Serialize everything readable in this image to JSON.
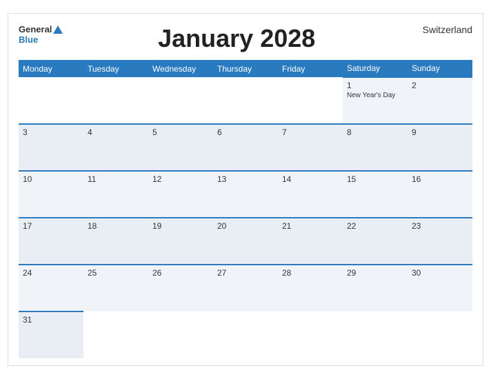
{
  "header": {
    "title": "January 2028",
    "country": "Switzerland",
    "logo_general": "General",
    "logo_blue": "Blue"
  },
  "weekdays": [
    "Monday",
    "Tuesday",
    "Wednesday",
    "Thursday",
    "Friday",
    "Saturday",
    "Sunday"
  ],
  "weeks": [
    [
      {
        "day": "",
        "holiday": ""
      },
      {
        "day": "",
        "holiday": ""
      },
      {
        "day": "",
        "holiday": ""
      },
      {
        "day": "",
        "holiday": ""
      },
      {
        "day": "",
        "holiday": ""
      },
      {
        "day": "1",
        "holiday": "New Year's Day"
      },
      {
        "day": "2",
        "holiday": ""
      }
    ],
    [
      {
        "day": "3",
        "holiday": ""
      },
      {
        "day": "4",
        "holiday": ""
      },
      {
        "day": "5",
        "holiday": ""
      },
      {
        "day": "6",
        "holiday": ""
      },
      {
        "day": "7",
        "holiday": ""
      },
      {
        "day": "8",
        "holiday": ""
      },
      {
        "day": "9",
        "holiday": ""
      }
    ],
    [
      {
        "day": "10",
        "holiday": ""
      },
      {
        "day": "11",
        "holiday": ""
      },
      {
        "day": "12",
        "holiday": ""
      },
      {
        "day": "13",
        "holiday": ""
      },
      {
        "day": "14",
        "holiday": ""
      },
      {
        "day": "15",
        "holiday": ""
      },
      {
        "day": "16",
        "holiday": ""
      }
    ],
    [
      {
        "day": "17",
        "holiday": ""
      },
      {
        "day": "18",
        "holiday": ""
      },
      {
        "day": "19",
        "holiday": ""
      },
      {
        "day": "20",
        "holiday": ""
      },
      {
        "day": "21",
        "holiday": ""
      },
      {
        "day": "22",
        "holiday": ""
      },
      {
        "day": "23",
        "holiday": ""
      }
    ],
    [
      {
        "day": "24",
        "holiday": ""
      },
      {
        "day": "25",
        "holiday": ""
      },
      {
        "day": "26",
        "holiday": ""
      },
      {
        "day": "27",
        "holiday": ""
      },
      {
        "day": "28",
        "holiday": ""
      },
      {
        "day": "29",
        "holiday": ""
      },
      {
        "day": "30",
        "holiday": ""
      }
    ],
    [
      {
        "day": "31",
        "holiday": ""
      },
      {
        "day": "",
        "holiday": ""
      },
      {
        "day": "",
        "holiday": ""
      },
      {
        "day": "",
        "holiday": ""
      },
      {
        "day": "",
        "holiday": ""
      },
      {
        "day": "",
        "holiday": ""
      },
      {
        "day": "",
        "holiday": ""
      }
    ]
  ]
}
